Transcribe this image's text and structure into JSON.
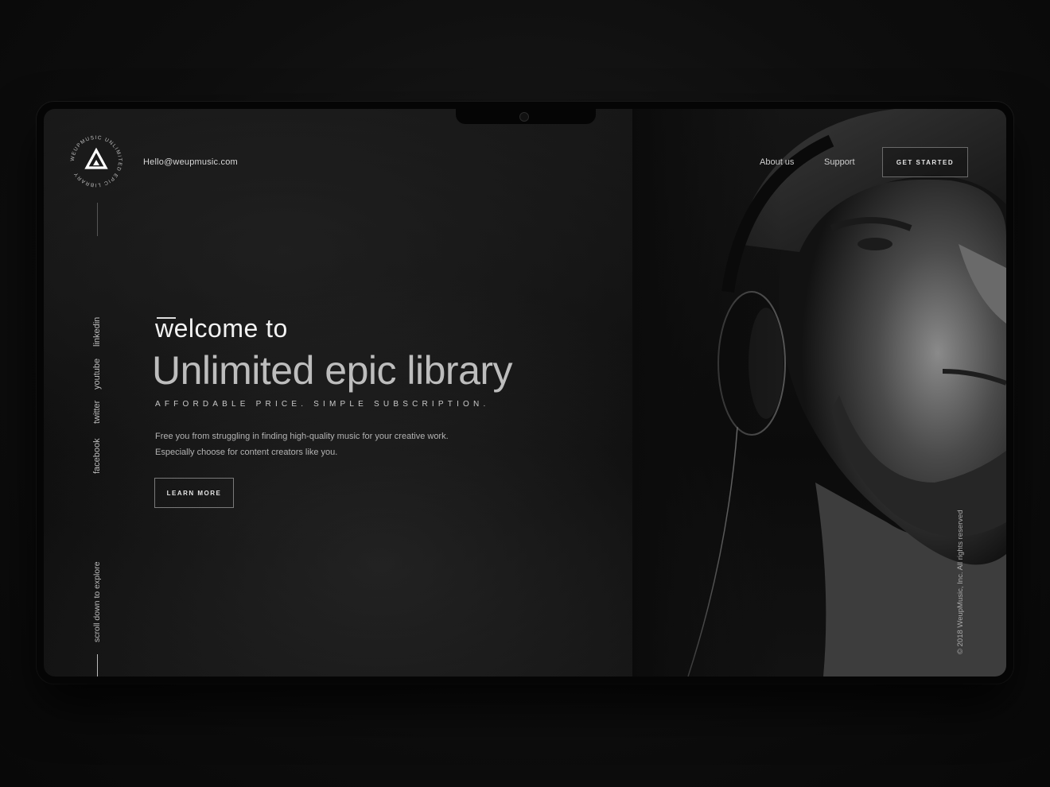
{
  "header": {
    "email": "Hello@weupmusic.com",
    "nav": {
      "about": "About us",
      "support": "Support"
    },
    "cta": "GET STARTED"
  },
  "logo": {
    "ring_text": "WEUPMUSIC  UNLIMITED EPIC LIBRARY"
  },
  "social": {
    "linkedin": "linkedin",
    "youtube": "youtube",
    "twitter": "twitter",
    "facebook": "facebook"
  },
  "hero": {
    "welcome": "welcome to",
    "headline": "Unlimited epic library",
    "tagline": "AFFORDABLE PRICE. SIMPLE SUBSCRIPTION.",
    "desc_line1": "Free you from struggling in finding high-quality music for your creative work.",
    "desc_line2": "Especially choose for content creators like you.",
    "cta": "LEARN MORE"
  },
  "footer": {
    "scroll": "scroll down to explore",
    "copyright": "© 2018 WeupMusic, Inc. All rights reserved"
  },
  "colors": {
    "background": "#0b0b0b",
    "text": "#d8d8d8",
    "accent": "#ffffff"
  }
}
